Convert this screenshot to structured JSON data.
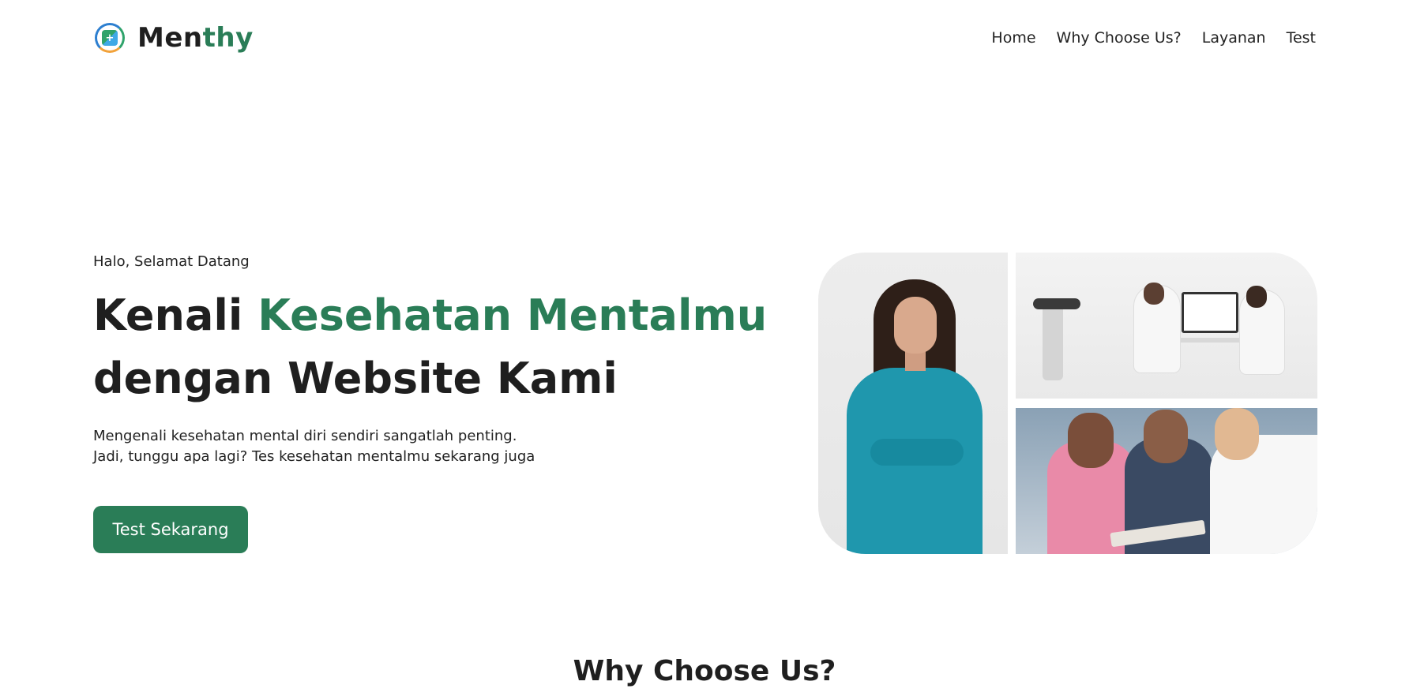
{
  "brand": {
    "name_part1": "Men",
    "name_part2": "thy",
    "logo_icon": "plus",
    "colors": {
      "dark": "#1f1f1f",
      "green": "#2a7d57"
    }
  },
  "nav": {
    "items": [
      {
        "label": "Home"
      },
      {
        "label": "Why Choose Us?"
      },
      {
        "label": "Layanan"
      },
      {
        "label": "Test"
      }
    ]
  },
  "hero": {
    "greeting": "Halo, Selamat Datang",
    "title_part1": "Kenali ",
    "title_accent": "Kesehatan Mentalmu",
    "title_part2": "dengan Website Kami",
    "description_line1": "Mengenali kesehatan mental diri sendiri sangatlah penting.",
    "description_line2": "Jadi, tunggu apa lagi? Tes kesehatan mentalmu sekarang juga",
    "cta_label": "Test Sekarang",
    "accent_color": "#2a7d57"
  },
  "section": {
    "why_title": "Why Choose Us?"
  }
}
